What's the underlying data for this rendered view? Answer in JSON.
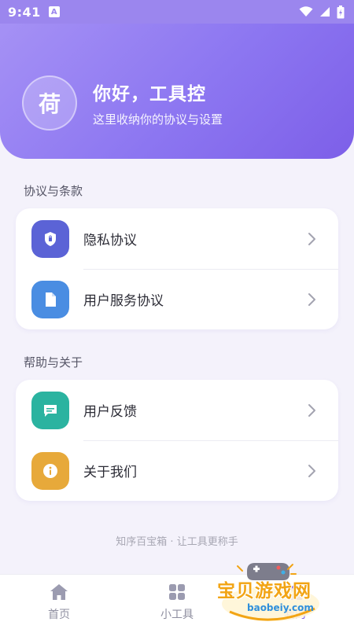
{
  "status_bar": {
    "time": "9:41",
    "notification_letter": "A"
  },
  "header": {
    "avatar_char": "荷",
    "greeting": "你好，工具控",
    "subtitle": "这里收纳你的协议与设置"
  },
  "sections": [
    {
      "title": "协议与条款",
      "items": [
        {
          "label": "隐私协议",
          "icon": "shield-icon",
          "color": "#5b63d6"
        },
        {
          "label": "用户服务协议",
          "icon": "document-icon",
          "color": "#4a8de2"
        }
      ]
    },
    {
      "title": "帮助与关于",
      "items": [
        {
          "label": "用户反馈",
          "icon": "chat-icon",
          "color": "#2bb3a0"
        },
        {
          "label": "关于我们",
          "icon": "info-icon",
          "color": "#e7a93a"
        }
      ]
    }
  ],
  "footer": {
    "tagline": "知序百宝箱 · 让工具更称手"
  },
  "tabs": [
    {
      "label": "首页",
      "icon": "home-icon",
      "active": false
    },
    {
      "label": "小工具",
      "icon": "grid-icon",
      "active": false
    },
    {
      "label": "我的",
      "icon": "profile-icon",
      "active": true
    }
  ],
  "watermark": {
    "title": "宝贝游戏网",
    "url": "baobeiy.com"
  },
  "colors": {
    "accent": "#7b5ce8",
    "header_start": "#a591f5",
    "header_end": "#7d5fe8"
  }
}
